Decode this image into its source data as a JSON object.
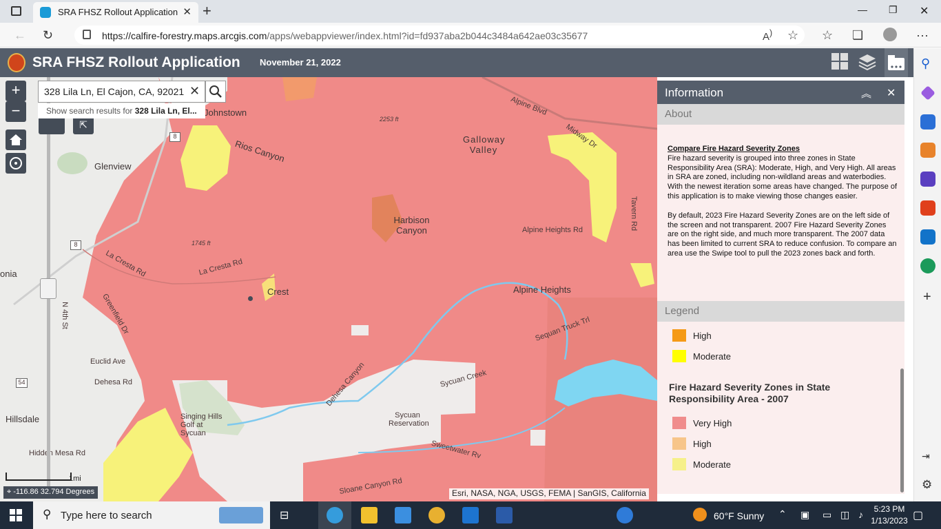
{
  "browser": {
    "tab_title": "SRA FHSZ Rollout Application",
    "url_host": "https://calfire-forestry.maps.arcgis.com",
    "url_path": "/apps/webappviewer/index.html?id=fd937aba2b044c3484a642ae03c35677"
  },
  "app": {
    "title": "SRA FHSZ Rollout Application",
    "date": "November 21, 2022"
  },
  "search": {
    "value": "328 Lila Ln, El Cajon, CA, 92021",
    "suggest_prefix": "Show search results for ",
    "suggest_term": "328 Lila Ln, El..."
  },
  "map": {
    "labels": {
      "johnstown": "Johnstown",
      "glenview": "Glenview",
      "rios_canyon": "Rios Canyon",
      "galloway_valley": "Galloway Valley",
      "harbison_canyon": "Harbison Canyon",
      "crest": "Crest",
      "alpine_heights": "Alpine Heights",
      "alpine_blvd": "Alpine Blvd",
      "alpine_heights_rd": "Alpine Heights Rd",
      "midway_dr": "Midway Dr",
      "la_cresta_rd": "La Cresta Rd",
      "la_cresta_rd2": "La Cresta Rd",
      "greenfield_dr": "Greenfield Dr",
      "euclid_ave": "Euclid Ave",
      "dehesa_rd": "Dehesa Rd",
      "dehesa_canyon": "Dehesa Canyon",
      "sycuan_reservation": "Sycuan Reservation",
      "sycuan_creek": "Sycuan Creek",
      "singing_hills": "Singing Hills Golf at Sycuan",
      "hillsdale": "Hillsdale",
      "sequan_truck_trl": "Sequan Truck Trl",
      "sloane_canyon_rd": "Sloane Canyon Rd",
      "sweetwater_rv": "Sweetwater Rv",
      "tavern_rd": "Tavern Rd",
      "elev_2253": "2253 ft",
      "elev_1745": "1745 ft",
      "onia": "onia",
      "n4th": "N 4th St",
      "hidden_mesa": "Hidden Mesa Rd",
      "route8a": "8",
      "route8b": "8",
      "route54": "54"
    },
    "coords": "-116.86  32.794 Degrees",
    "scale": "1mi",
    "attribution": "Esri, NASA, NGA, USGS, FEMA | SanGIS, California"
  },
  "panel": {
    "title": "Information",
    "about_header": "About",
    "about_title": "Compare Fire Hazard Severity Zones",
    "about_p1": "Fire hazard severity is grouped into three zones in State Responsibility Area (SRA): Moderate, High, and Very High. All areas in SRA are zoned, including non-wildland areas and waterbodies. With the newest iteration some areas have changed. The purpose of this application is to make viewing those changes easier.",
    "about_p2": "By default, 2023 Fire Hazard Severity Zones are on the left side of the screen and not transparent. 2007 Fire Hazard Severity Zones are on the right side, and much more transparent. The 2007 data has been limited to current SRA to reduce confusion. To compare an area use the Swipe tool to pull the 2023 zones back and forth.",
    "legend_header": "Legend",
    "legend_2023": [
      {
        "label": "High",
        "color": "#f59a16"
      },
      {
        "label": "Moderate",
        "color": "#ffff00"
      }
    ],
    "legend_2007_title": "Fire Hazard Severity Zones in State Responsibility Area - 2007",
    "legend_2007": [
      {
        "label": "Very High",
        "color": "#f08c8c"
      },
      {
        "label": "High",
        "color": "#f7c58a"
      },
      {
        "label": "Moderate",
        "color": "#f6f08a"
      }
    ]
  },
  "colors": {
    "very_high": "#f08a88",
    "high": "#f5a05a",
    "moderate": "#f7f27a",
    "water": "#7fd6f2",
    "header": "#555e6b"
  },
  "taskbar": {
    "search_placeholder": "Type here to search",
    "weather": "60°F  Sunny",
    "time": "5:23 PM",
    "date": "1/13/2023"
  }
}
